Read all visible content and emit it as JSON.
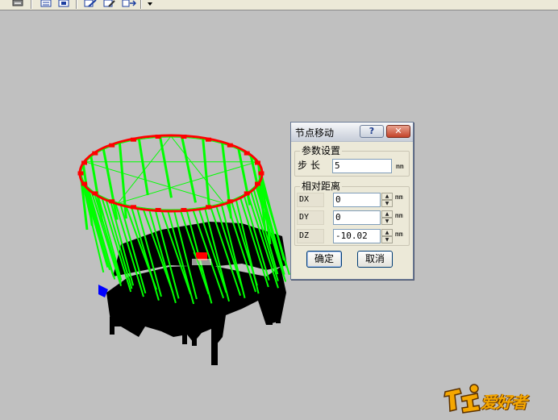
{
  "toolbar": {
    "icons": [
      "print-icon",
      "list-icon",
      "page-icon",
      "edit-pencil-icon",
      "document-edit-icon",
      "move-node-icon",
      "dropdown-arrow-icon"
    ]
  },
  "dialog": {
    "title": "节点移动",
    "help_label": "?",
    "close_label": "✕",
    "param_group": {
      "label": "参数设置",
      "step_label": "步 长",
      "step_value": "5",
      "step_unit": "mm"
    },
    "distance_group": {
      "label": "相对距离",
      "rows": [
        {
          "label": "DX",
          "value": "0",
          "unit": "mm"
        },
        {
          "label": "DY",
          "value": "0",
          "unit": "mm"
        },
        {
          "label": "DZ",
          "value": "-10.02",
          "unit": "mm"
        }
      ]
    },
    "ok_label": "确定",
    "cancel_label": "取消"
  },
  "watermark": {
    "text": "爱好者"
  },
  "colors": {
    "background": "#c0c0c0",
    "ring": "#ff0000",
    "wire": "#00ff00",
    "solid": "#000000",
    "marker": "#0000ff"
  }
}
